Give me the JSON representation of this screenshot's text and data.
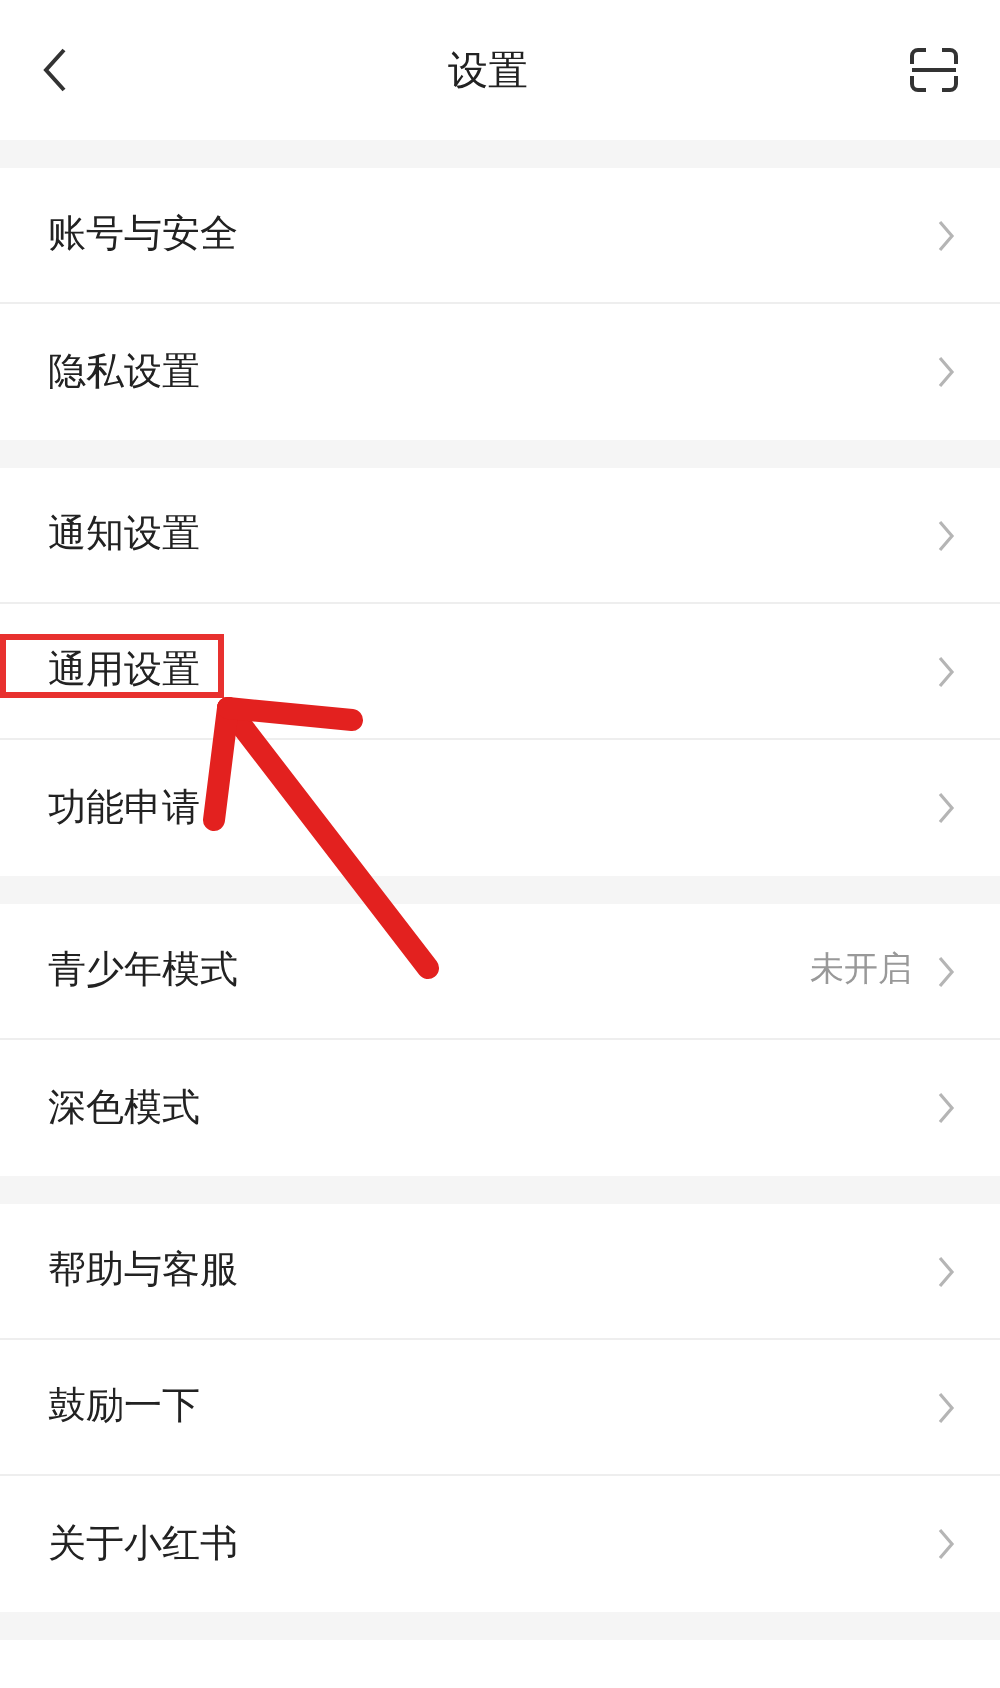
{
  "header": {
    "title": "设置"
  },
  "groups": [
    {
      "items": [
        {
          "label": "账号与安全",
          "highlighted": false
        },
        {
          "label": "隐私设置",
          "highlighted": false
        }
      ]
    },
    {
      "items": [
        {
          "label": "通知设置",
          "highlighted": false
        },
        {
          "label": "通用设置",
          "highlighted": true
        },
        {
          "label": "功能申请",
          "highlighted": false
        }
      ]
    },
    {
      "items": [
        {
          "label": "青少年模式",
          "value": "未开启",
          "highlighted": false
        },
        {
          "label": "深色模式",
          "highlighted": false
        }
      ]
    },
    {
      "items": [
        {
          "label": "帮助与客服",
          "highlighted": false
        },
        {
          "label": "鼓励一下",
          "highlighted": false
        },
        {
          "label": "关于小红书",
          "highlighted": false
        }
      ]
    }
  ]
}
